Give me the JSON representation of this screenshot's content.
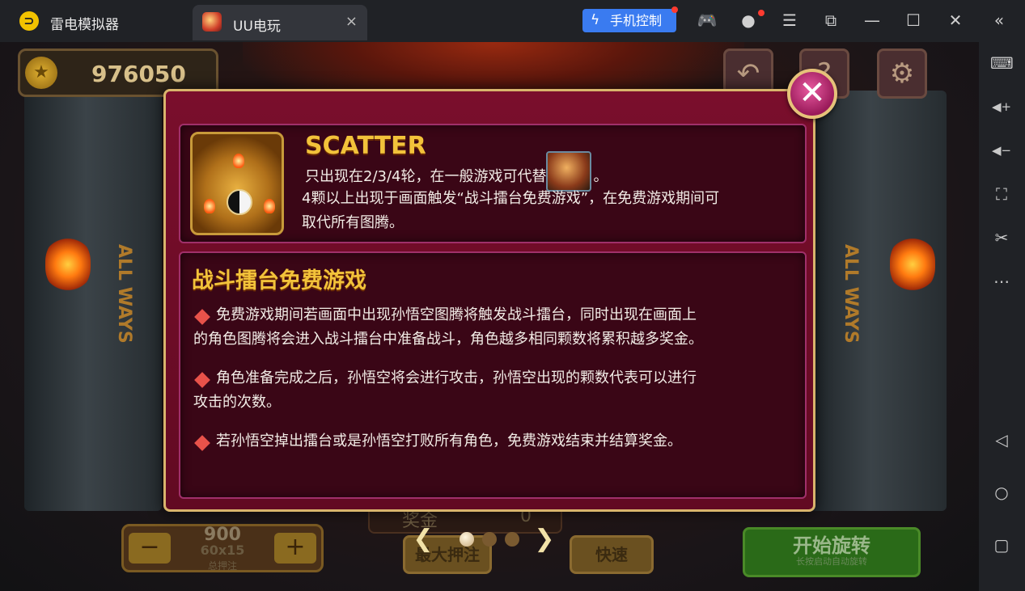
{
  "titlebar": {
    "app_name": "雷电模拟器",
    "tab_title": "UU电玩",
    "phone_control": "手机控制"
  },
  "game": {
    "coins": "976050",
    "pillar_text": "ALL WAYS",
    "bet": {
      "total": "900",
      "lines": "60x15",
      "label": "总押注",
      "minus": "−",
      "plus": "+"
    },
    "win": {
      "label": "奖金",
      "value": "0"
    },
    "max_bet": "最大押注",
    "fast": "快速",
    "spin": "开始旋转",
    "spin_sub": "长按启动自动旋转"
  },
  "modal": {
    "close": "✕",
    "scatter": {
      "title": "SCATTER",
      "line1_a": "只出现在2/3/4轮，在一般游戏可代替",
      "line1_b": "。",
      "line2": "4颗以上出现于画面触发“战斗擂台免费游戏”，在免费游戏期间可",
      "line3": "取代所有图腾。"
    },
    "rules": {
      "title": "战斗擂台免费游戏",
      "items": [
        {
          "line1": "免费游戏期间若画面中出现孙悟空图腾将触发战斗擂台，同时出现在画面上",
          "line2": "的角色图腾将会进入战斗擂台中准备战斗，角色越多相同颗数将累积越多奖金。"
        },
        {
          "line1": "角色准备完成之后，孙悟空将会进行攻击，孙悟空出现的颗数代表可以进行",
          "line2": "攻击的次数。"
        },
        {
          "line1": "若孙悟空掉出擂台或是孙悟空打败所有角色，免费游戏结束并结算奖金。",
          "line2": ""
        }
      ]
    },
    "pager": {
      "prev": "❮",
      "next": "❯",
      "pages": 3,
      "current": 1
    }
  },
  "icons": {
    "tab_close": "×",
    "gamepad": "🎮",
    "user": "●",
    "menu": "☰",
    "popout": "⧉",
    "minimize": "—",
    "maximize": "☐",
    "close": "✕",
    "collapse": "«",
    "keyboard": "⌨",
    "volume_up": "◀+",
    "volume_down": "◀−",
    "screenshot": "⛶",
    "scissors": "✂",
    "more": "⋯",
    "back": "◁",
    "home": "○",
    "recents": "▢",
    "undo": "↶",
    "help": "?",
    "settings": "⚙",
    "coin": "★"
  },
  "colors": {
    "accent_blue": "#3a7bf0",
    "modal_bg": "#7a0e2c",
    "gold_title": "#f2c23a",
    "bullet_red": "#e8524a"
  }
}
